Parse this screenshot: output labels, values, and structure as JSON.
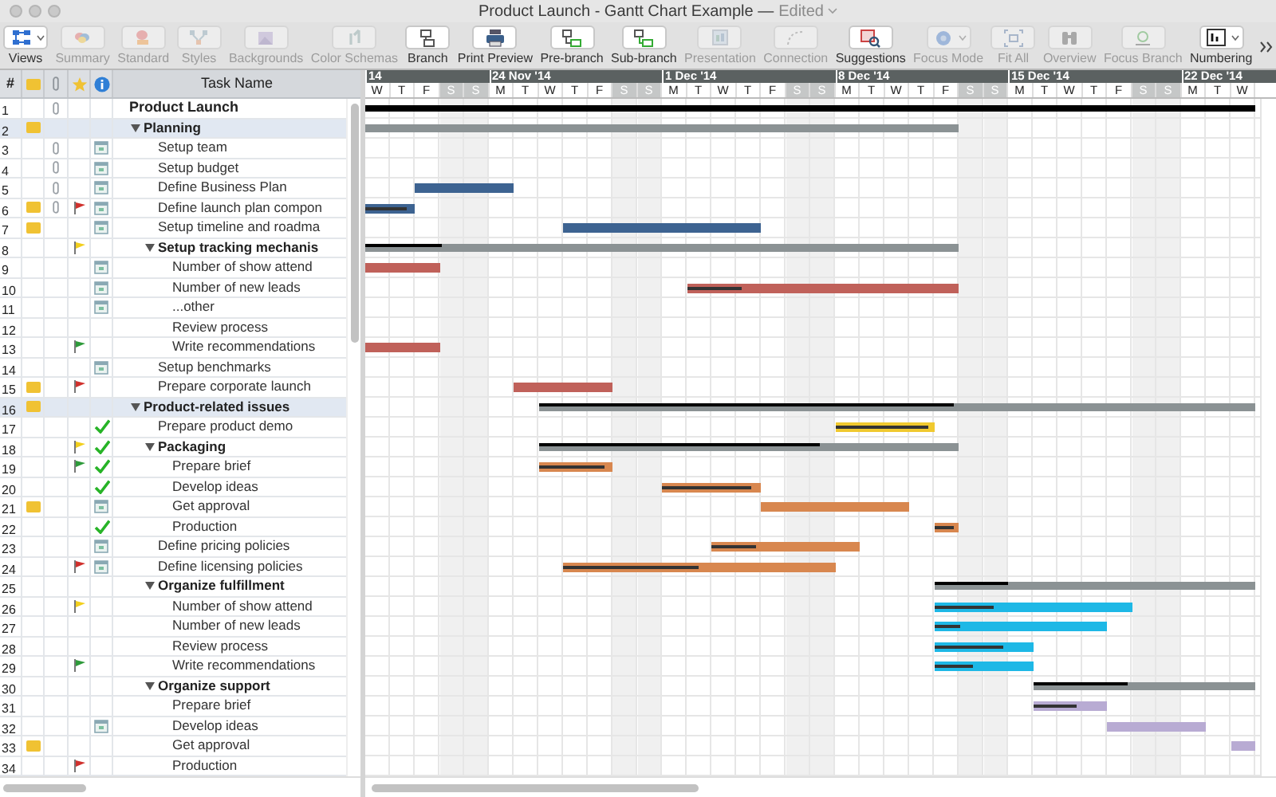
{
  "window": {
    "title": "Product Launch - Gantt Chart Example —",
    "status": "Edited"
  },
  "toolbar": [
    {
      "label": "Views",
      "disabled": false,
      "menu": true
    },
    {
      "label": "Summary",
      "disabled": true,
      "menu": false
    },
    {
      "label": "Standard",
      "disabled": true,
      "menu": false
    },
    {
      "label": "Styles",
      "disabled": true,
      "menu": false
    },
    {
      "label": "Backgrounds",
      "disabled": true,
      "menu": false
    },
    {
      "label": "Color Schemas",
      "disabled": true,
      "menu": false
    },
    {
      "label": "Branch",
      "disabled": false,
      "menu": false
    },
    {
      "label": "Print Preview",
      "disabled": false,
      "menu": false
    },
    {
      "label": "Pre-branch",
      "disabled": false,
      "menu": false
    },
    {
      "label": "Sub-branch",
      "disabled": false,
      "menu": false
    },
    {
      "label": "Presentation",
      "disabled": true,
      "menu": false
    },
    {
      "label": "Connection",
      "disabled": true,
      "menu": false
    },
    {
      "label": "Suggestions",
      "disabled": false,
      "menu": false
    },
    {
      "label": "Focus Mode",
      "disabled": true,
      "menu": true
    },
    {
      "label": "Fit All",
      "disabled": true,
      "menu": false
    },
    {
      "label": "Overview",
      "disabled": true,
      "menu": false
    },
    {
      "label": "Focus Branch",
      "disabled": true,
      "menu": false
    },
    {
      "label": "Numbering",
      "disabled": false,
      "menu": true
    }
  ],
  "table": {
    "columns": {
      "number": "#",
      "name": "Task Name"
    }
  },
  "timeline": {
    "weeks": [
      {
        "label": "14"
      },
      {
        "label": "24 Nov '14"
      },
      {
        "label": "1 Dec '14"
      },
      {
        "label": "8 Dec '14"
      },
      {
        "label": "15 Dec '14"
      },
      {
        "label": "22 Dec '14"
      }
    ],
    "days": [
      {
        "letter": "W",
        "weekend": false
      },
      {
        "letter": "T",
        "weekend": false
      },
      {
        "letter": "F",
        "weekend": false
      },
      {
        "letter": "S",
        "weekend": true
      },
      {
        "letter": "S",
        "weekend": true
      },
      {
        "letter": "M",
        "weekend": false
      },
      {
        "letter": "T",
        "weekend": false
      },
      {
        "letter": "W",
        "weekend": false
      },
      {
        "letter": "T",
        "weekend": false
      },
      {
        "letter": "F",
        "weekend": false
      },
      {
        "letter": "S",
        "weekend": true
      },
      {
        "letter": "S",
        "weekend": true
      },
      {
        "letter": "M",
        "weekend": false
      },
      {
        "letter": "T",
        "weekend": false
      },
      {
        "letter": "W",
        "weekend": false
      },
      {
        "letter": "T",
        "weekend": false
      },
      {
        "letter": "F",
        "weekend": false
      },
      {
        "letter": "S",
        "weekend": true
      },
      {
        "letter": "S",
        "weekend": true
      },
      {
        "letter": "M",
        "weekend": false
      },
      {
        "letter": "T",
        "weekend": false
      },
      {
        "letter": "W",
        "weekend": false
      },
      {
        "letter": "T",
        "weekend": false
      },
      {
        "letter": "F",
        "weekend": false
      },
      {
        "letter": "S",
        "weekend": true
      },
      {
        "letter": "S",
        "weekend": true
      },
      {
        "letter": "M",
        "weekend": false
      },
      {
        "letter": "T",
        "weekend": false
      },
      {
        "letter": "W",
        "weekend": false
      },
      {
        "letter": "T",
        "weekend": false
      },
      {
        "letter": "F",
        "weekend": false
      },
      {
        "letter": "S",
        "weekend": true
      },
      {
        "letter": "S",
        "weekend": true
      },
      {
        "letter": "M",
        "weekend": false
      },
      {
        "letter": "T",
        "weekend": false
      },
      {
        "letter": "W",
        "weekend": false
      }
    ]
  },
  "rows": [
    {
      "number": "1",
      "name": "Product Launch",
      "kind": "project",
      "selected": false,
      "note": false,
      "attachment": true,
      "children": [
        {
          "number": "2",
          "name": "Planning",
          "kind": "group",
          "expanded": true,
          "selected": true,
          "note": true,
          "attachment": false,
          "bar": {
            "color": "#8b9294"
          },
          "children": [
            {
              "number": "3",
              "name": "Setup team",
              "kind": "task",
              "selected": false,
              "note": false,
              "attachment": true,
              "info": {
                "kind": "scheduled"
              }
            },
            {
              "number": "4",
              "name": "Setup budget",
              "kind": "task",
              "selected": false,
              "note": false,
              "attachment": true,
              "info": {
                "kind": "scheduled"
              }
            },
            {
              "number": "5",
              "name": "Define Business Plan",
              "kind": "task",
              "selected": false,
              "note": false,
              "attachment": true,
              "info": {
                "kind": "scheduled"
              },
              "bar": {
                "color": "#3d6391"
              }
            },
            {
              "number": "6",
              "name": "Define launch plan compon",
              "kind": "task",
              "selected": false,
              "note": true,
              "attachment": true,
              "flag": {
                "color": "#d0312d"
              },
              "info": {
                "kind": "scheduled"
              },
              "bar": {
                "color": "#3d6391",
                "level": 0.85
              }
            },
            {
              "number": "7",
              "name": "Setup timeline and roadma",
              "kind": "task",
              "selected": false,
              "note": true,
              "attachment": false,
              "info": {
                "kind": "scheduled"
              },
              "bar": {
                "color": "#3d6391"
              }
            },
            {
              "number": "8",
              "name": "Setup tracking mechanis",
              "kind": "group",
              "expanded": true,
              "selected": false,
              "note": false,
              "attachment": false,
              "flag": {
                "color": "#f2cf1d"
              },
              "bar": {
                "color": "#8b9294",
                "level": 0.13
              },
              "children": [
                {
                  "number": "9",
                  "name": "Number of show attend",
                  "kind": "task",
                  "selected": false,
                  "note": false,
                  "attachment": false,
                  "info": {
                    "kind": "scheduled"
                  },
                  "bar": {
                    "color": "#c0615a"
                  }
                },
                {
                  "number": "10",
                  "name": "Number of new leads",
                  "kind": "task",
                  "selected": false,
                  "note": false,
                  "attachment": false,
                  "info": {
                    "kind": "scheduled"
                  },
                  "bar": {
                    "color": "#c0615a",
                    "level": 0.2
                  }
                },
                {
                  "number": "11",
                  "name": "...other",
                  "kind": "task",
                  "selected": false,
                  "note": false,
                  "attachment": false,
                  "info": {
                    "kind": "scheduled"
                  }
                },
                {
                  "number": "12",
                  "name": "Review process",
                  "kind": "task",
                  "selected": false,
                  "note": false,
                  "attachment": false
                },
                {
                  "number": "13",
                  "name": "Write recommendations",
                  "kind": "task",
                  "selected": false,
                  "note": false,
                  "attachment": false,
                  "flag": {
                    "color": "#2e9a3a"
                  },
                  "bar": {
                    "color": "#c0615a"
                  }
                }
              ]
            },
            {
              "number": "14",
              "name": "Setup benchmarks",
              "kind": "task",
              "selected": false,
              "note": false,
              "attachment": false,
              "info": {
                "kind": "scheduled"
              }
            },
            {
              "number": "15",
              "name": "Prepare corporate launch",
              "kind": "task",
              "selected": false,
              "note": true,
              "attachment": false,
              "flag": {
                "color": "#d0312d"
              },
              "bar": {
                "color": "#c0615a"
              }
            }
          ]
        },
        {
          "number": "16",
          "name": "Product-related issues",
          "kind": "group",
          "expanded": true,
          "selected": true,
          "note": true,
          "attachment": false,
          "bar": {
            "color": "#8b9294",
            "level": 0.58
          },
          "children": [
            {
              "number": "17",
              "name": "Prepare product demo",
              "kind": "task",
              "selected": false,
              "note": false,
              "attachment": false,
              "info": {
                "kind": "done"
              },
              "bar": {
                "color": "#f0c92f",
                "level": 0.95
              }
            },
            {
              "number": "18",
              "name": "Packaging",
              "kind": "group",
              "expanded": true,
              "selected": false,
              "note": false,
              "attachment": false,
              "flag": {
                "color": "#f2cf1d"
              },
              "info": {
                "kind": "done"
              },
              "bar": {
                "color": "#8b9294",
                "level": 0.67
              },
              "children": [
                {
                  "number": "19",
                  "name": "Prepare brief",
                  "kind": "task",
                  "selected": false,
                  "note": false,
                  "attachment": false,
                  "flag": {
                    "color": "#2e9a3a"
                  },
                  "info": {
                    "kind": "done"
                  },
                  "bar": {
                    "color": "#d8874f",
                    "level": 0.9
                  }
                },
                {
                  "number": "20",
                  "name": "Develop ideas",
                  "kind": "task",
                  "selected": false,
                  "note": false,
                  "attachment": false,
                  "info": {
                    "kind": "done"
                  },
                  "bar": {
                    "color": "#d8874f",
                    "level": 0.9
                  }
                },
                {
                  "number": "21",
                  "name": "Get approval",
                  "kind": "task",
                  "selected": false,
                  "note": true,
                  "attachment": false,
                  "info": {
                    "kind": "scheduled"
                  },
                  "bar": {
                    "color": "#d8874f"
                  }
                },
                {
                  "number": "22",
                  "name": "Production",
                  "kind": "task",
                  "selected": false,
                  "note": false,
                  "attachment": false,
                  "info": {
                    "kind": "done"
                  },
                  "bar": {
                    "color": "#d8874f",
                    "level": 0.8
                  }
                }
              ]
            },
            {
              "number": "23",
              "name": "Define pricing policies",
              "kind": "task",
              "selected": false,
              "note": false,
              "attachment": false,
              "info": {
                "kind": "scheduled"
              },
              "bar": {
                "color": "#d8874f",
                "level": 0.3
              }
            },
            {
              "number": "24",
              "name": "Define licensing policies",
              "kind": "task",
              "selected": false,
              "note": false,
              "attachment": false,
              "flag": {
                "color": "#d0312d"
              },
              "info": {
                "kind": "scheduled"
              },
              "bar": {
                "color": "#d8874f",
                "level": 0.5
              }
            },
            {
              "number": "25",
              "name": "Organize fulfillment",
              "kind": "group",
              "expanded": true,
              "selected": false,
              "note": false,
              "attachment": false,
              "bar": {
                "color": "#8b9294",
                "level": 0.23
              },
              "children": [
                {
                  "number": "26",
                  "name": "Number of show attend",
                  "kind": "task",
                  "selected": false,
                  "note": false,
                  "attachment": false,
                  "flag": {
                    "color": "#f2cf1d"
                  },
                  "bar": {
                    "color": "#1eb8e6",
                    "level": 0.3
                  }
                },
                {
                  "number": "27",
                  "name": "Number of new leads",
                  "kind": "task",
                  "selected": false,
                  "note": false,
                  "attachment": false,
                  "bar": {
                    "color": "#1eb8e6",
                    "level": 0.15
                  }
                },
                {
                  "number": "28",
                  "name": "Review process",
                  "kind": "task",
                  "selected": false,
                  "note": false,
                  "attachment": false,
                  "bar": {
                    "color": "#1eb8e6",
                    "level": 0.7
                  }
                },
                {
                  "number": "29",
                  "name": "Write recommendations",
                  "kind": "task",
                  "selected": false,
                  "note": false,
                  "attachment": false,
                  "flag": {
                    "color": "#2e9a3a"
                  },
                  "bar": {
                    "color": "#1eb8e6",
                    "level": 0.4
                  }
                }
              ]
            },
            {
              "number": "30",
              "name": "Organize support",
              "kind": "group",
              "expanded": true,
              "selected": false,
              "note": false,
              "attachment": false,
              "bar": {
                "color": "#8b9294",
                "level": 0.43
              },
              "children": [
                {
                  "number": "31",
                  "name": "Prepare brief",
                  "kind": "task",
                  "selected": false,
                  "note": false,
                  "attachment": false,
                  "bar": {
                    "color": "#b8abd3",
                    "level": 0.6
                  }
                },
                {
                  "number": "32",
                  "name": "Develop ideas",
                  "kind": "task",
                  "selected": false,
                  "note": false,
                  "attachment": false,
                  "info": {
                    "kind": "scheduled"
                  },
                  "bar": {
                    "color": "#b8abd3"
                  }
                },
                {
                  "number": "33",
                  "name": "Get approval",
                  "kind": "task",
                  "selected": false,
                  "note": true,
                  "attachment": false,
                  "bar": {
                    "color": "#b8abd3"
                  }
                },
                {
                  "number": "34",
                  "name": "Production",
                  "kind": "task",
                  "selected": false,
                  "note": false,
                  "attachment": false,
                  "flag": {
                    "color": "#d0312d"
                  }
                }
              ]
            }
          ]
        }
      ]
    }
  ]
}
